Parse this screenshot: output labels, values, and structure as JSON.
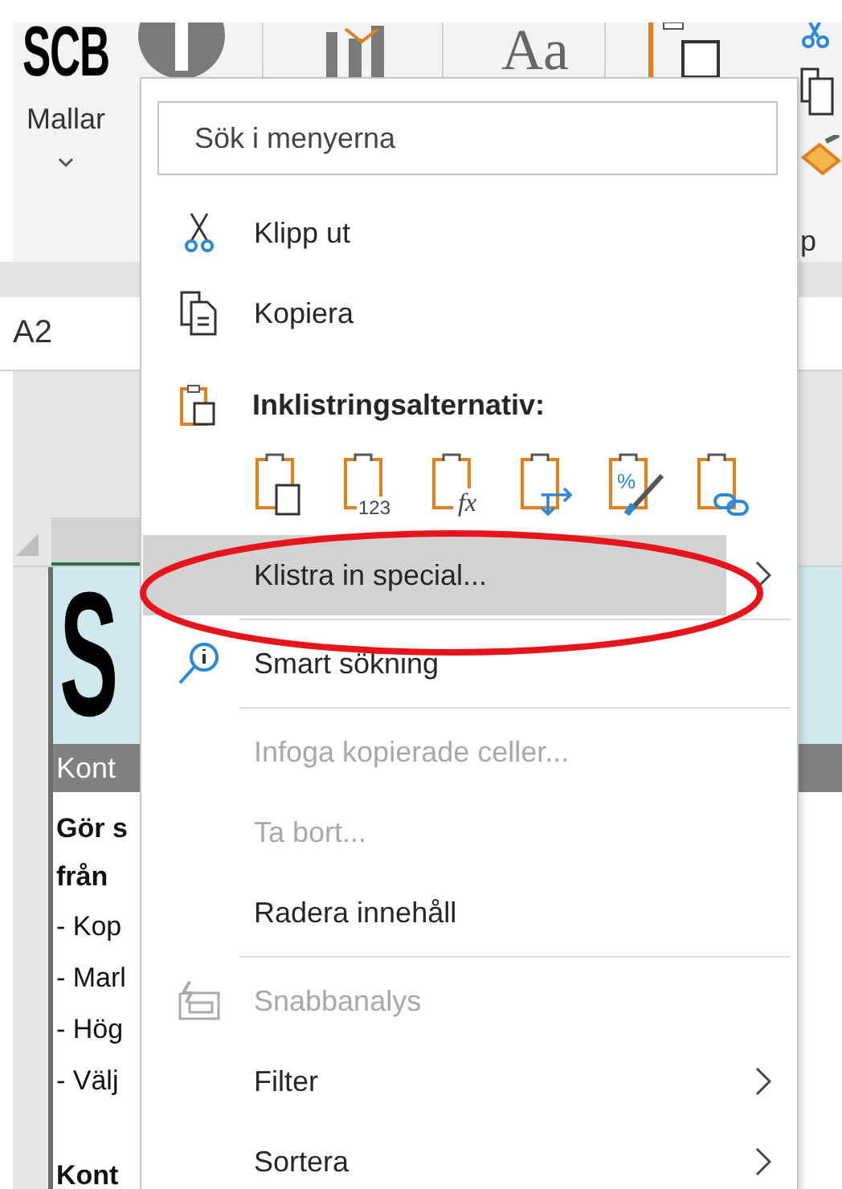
{
  "ribbon": {
    "logo": "SCB",
    "templates_label": "Mallar",
    "font_glyph": "Aa",
    "cut_label": "p"
  },
  "name_box": {
    "value": "A2"
  },
  "sheet": {
    "logo": "S",
    "banner": "Kont",
    "paragraphs": [
      {
        "lines": [
          {
            "text": "Gör s",
            "bold": true
          },
          {
            "text": "från",
            "bold": true
          },
          {
            "text": "- Kop",
            "bold": false
          },
          {
            "text": "- Marl",
            "bold": false
          },
          {
            "text": "- Hög",
            "bold": false
          },
          {
            "text": "- Välj",
            "bold": false
          }
        ]
      },
      {
        "lines": [
          {
            "text": "Kont",
            "bold": true
          }
        ]
      }
    ]
  },
  "menu": {
    "search": {
      "placeholder": "Sök i menyerna"
    },
    "items": [
      {
        "kind": "cut",
        "label": "Klipp ut",
        "disabled": false,
        "submenu": false,
        "selected": false
      },
      {
        "kind": "copy",
        "label": "Kopiera",
        "disabled": false,
        "submenu": false,
        "selected": false
      },
      {
        "kind": "header",
        "label": "Inklistringsalternativ:"
      },
      {
        "kind": "paste_options",
        "options": [
          {
            "kind": "all"
          },
          {
            "kind": "values",
            "glyph": "123"
          },
          {
            "kind": "formulas",
            "glyph": "fx"
          },
          {
            "kind": "transpose"
          },
          {
            "kind": "formatting",
            "glyph": "%"
          },
          {
            "kind": "link"
          }
        ]
      },
      {
        "kind": "paste_special",
        "label": "Klistra in special...",
        "disabled": false,
        "submenu": true,
        "selected": true
      },
      {
        "kind": "divider"
      },
      {
        "kind": "lookup",
        "label": "Smart sökning",
        "disabled": false,
        "submenu": false,
        "selected": false
      },
      {
        "kind": "divider"
      },
      {
        "kind": "insert",
        "label": "Infoga kopierade celler...",
        "disabled": true,
        "submenu": false,
        "selected": false
      },
      {
        "kind": "delete",
        "label": "Ta bort...",
        "disabled": true,
        "submenu": false,
        "selected": false
      },
      {
        "kind": "clear",
        "label": "Radera innehåll",
        "disabled": false,
        "submenu": false,
        "selected": false
      },
      {
        "kind": "divider"
      },
      {
        "kind": "quick",
        "label": "Snabbanalys",
        "disabled": true,
        "submenu": false,
        "selected": false
      },
      {
        "kind": "filter",
        "label": "Filter",
        "disabled": false,
        "submenu": true,
        "selected": false
      },
      {
        "kind": "sort",
        "label": "Sortera",
        "disabled": false,
        "submenu": true,
        "selected": false
      }
    ]
  },
  "annotation": {
    "kind": "ellipse"
  }
}
